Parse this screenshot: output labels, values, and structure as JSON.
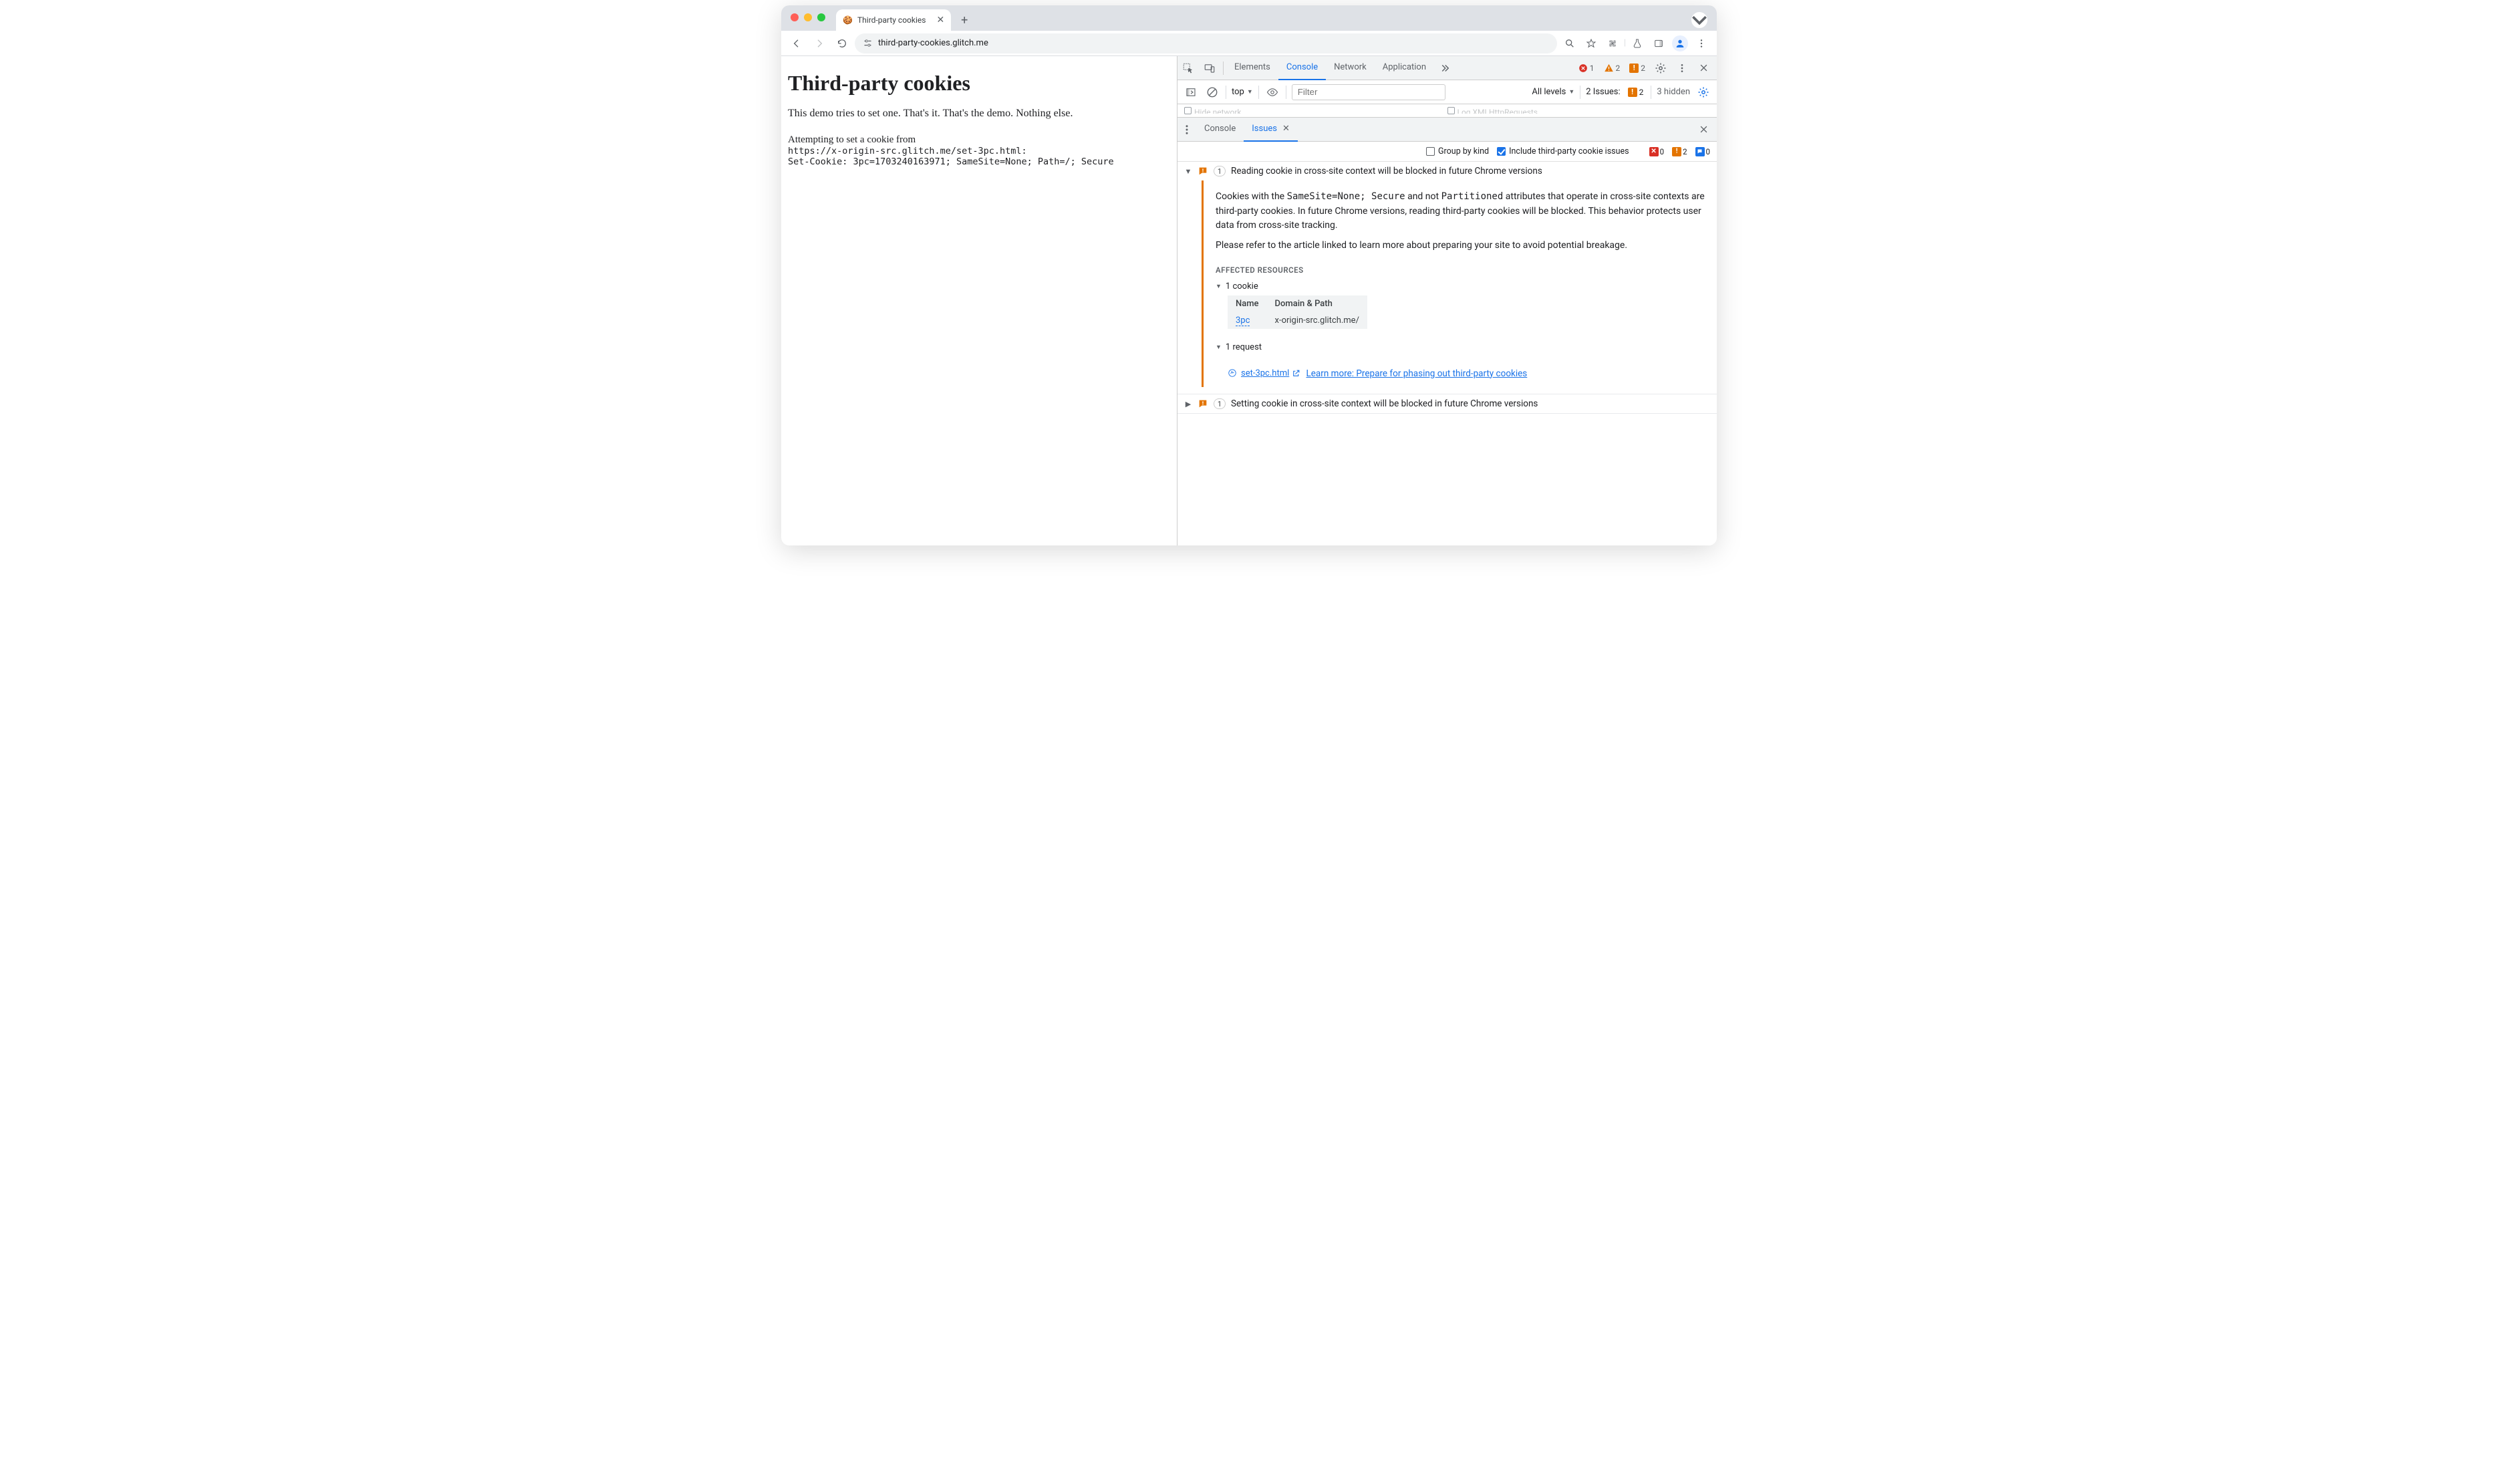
{
  "browser": {
    "tab_title": "Third-party cookies",
    "url": "third-party-cookies.glitch.me"
  },
  "page": {
    "h1": "Third-party cookies",
    "intro": "This demo tries to set one. That's it. That's the demo. Nothing else.",
    "prelude": "Attempting to set a cookie from",
    "code1": "https://x-origin-src.glitch.me/set-3pc.html:",
    "code2": "Set-Cookie: 3pc=1703240163971; SameSite=None; Path=/; Secure"
  },
  "devtools": {
    "tabs": {
      "elements": "Elements",
      "console": "Console",
      "network": "Network",
      "application": "Application"
    },
    "top_errors": "1",
    "top_warnings": "2",
    "top_issues": "2",
    "toolbar": {
      "context": "top",
      "filter_placeholder": "Filter",
      "levels": "All levels",
      "issues_label": "2 Issues:",
      "issues_count": "2",
      "hidden": "3 hidden"
    },
    "row3": {
      "left_label_frag": "Hide network",
      "right_label_frag": "Log XMLHttpRequests"
    },
    "drawer": {
      "console": "Console",
      "issues": "Issues",
      "group_by_kind": "Group by kind",
      "include_3p": "Include third-party cookie issues",
      "cnt_err": "0",
      "cnt_warn": "2",
      "cnt_info": "0"
    },
    "issue1": {
      "count": "1",
      "title": "Reading cookie in cross-site context will be blocked in future Chrome versions",
      "p1a": "Cookies with the ",
      "code_ss": "SameSite=None; Secure",
      "p1b": " and not ",
      "code_pt": "Partitioned",
      "p1c": " attributes that operate in cross-site contexts are third-party cookies. In future Chrome versions, reading third-party cookies will be blocked. This behavior protects user data from cross-site tracking.",
      "p2": "Please refer to the article linked to learn more about preparing your site to avoid potential breakage.",
      "ar_head": "AFFECTED RESOURCES",
      "cookie_sub": "1 cookie",
      "tbl_name": "Name",
      "tbl_dp": "Domain & Path",
      "cookie_name": "3pc",
      "cookie_dp": "x-origin-src.glitch.me/",
      "req_sub": "1 request",
      "req_link": "set-3pc.html",
      "learn": "Learn more: Prepare for phasing out third-party cookies"
    },
    "issue2": {
      "count": "1",
      "title": "Setting cookie in cross-site context will be blocked in future Chrome versions"
    }
  }
}
